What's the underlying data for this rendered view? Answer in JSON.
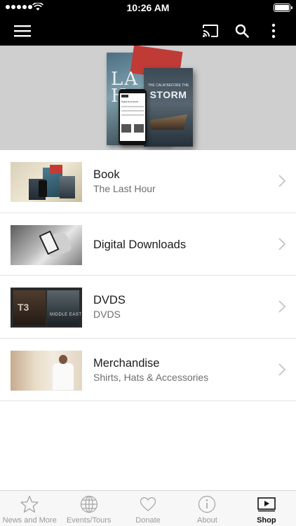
{
  "status_bar": {
    "time": "10:26 AM"
  },
  "nav": {
    "icons": [
      "menu-icon",
      "cast-icon",
      "search-icon",
      "more-vertical-icon"
    ]
  },
  "hero": {
    "book_back_title": "LA\nH",
    "book_front_title": "STORM",
    "book_front_subtitle": "THE CALM BEFORE THE",
    "phone_text": "Digital Downloads"
  },
  "shop_items": [
    {
      "title": "Book",
      "subtitle": "The Last Hour",
      "thumbnail": "book"
    },
    {
      "title": "Digital Downloads",
      "subtitle": "",
      "thumbnail": "downloads"
    },
    {
      "title": "DVDS",
      "subtitle": "DVDS",
      "thumbnail": "dvds"
    },
    {
      "title": "Merchandise",
      "subtitle": "Shirts, Hats & Accessories",
      "thumbnail": "merch"
    }
  ],
  "thumbs": {
    "dvd_t3": "T3",
    "dvd_me": "MIDDLE EAST"
  },
  "tabs": [
    {
      "label": "News and More",
      "icon": "star-icon",
      "active": false
    },
    {
      "label": "Events/Tours",
      "icon": "globe-icon",
      "active": false
    },
    {
      "label": "Donate",
      "icon": "heart-icon",
      "active": false
    },
    {
      "label": "About",
      "icon": "info-icon",
      "active": false
    },
    {
      "label": "Shop",
      "icon": "play-screen-icon",
      "active": true
    }
  ],
  "colors": {
    "nav_bg": "#000000",
    "hero_bg": "#cfcfcf",
    "tab_active": "#111111",
    "tab_inactive": "#9a9a9a"
  }
}
